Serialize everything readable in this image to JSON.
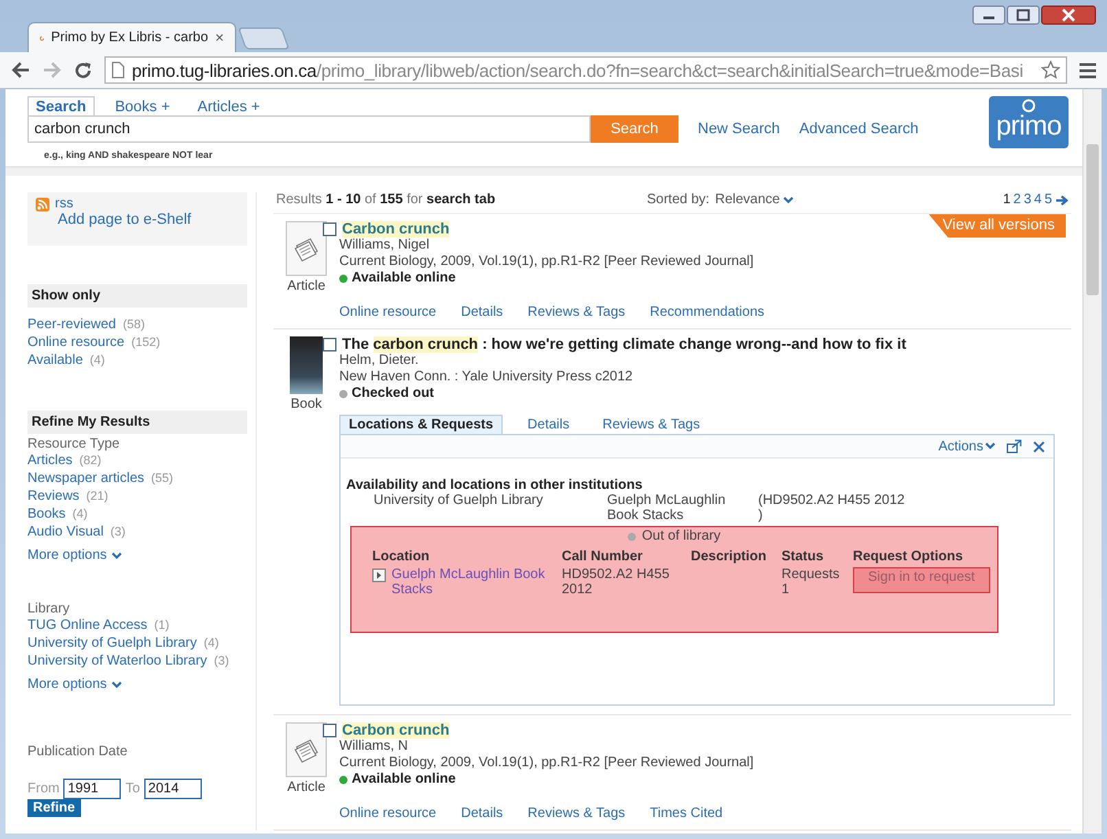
{
  "browser": {
    "tab_title": "Primo by Ex Libris - carbo",
    "tab_close": "×",
    "url_host": "primo.tug-libraries.on.ca",
    "url_path": "/primo_library/libweb/action/search.do?fn=search&ct=search&initialSearch=true&mode=Basi"
  },
  "search": {
    "tabs": [
      {
        "label": "Search",
        "selected": true
      },
      {
        "label": "Books +",
        "selected": false
      },
      {
        "label": "Articles +",
        "selected": false
      }
    ],
    "query": "carbon crunch",
    "button": "Search",
    "links": [
      "New Search",
      "Advanced Search"
    ],
    "hint": "e.g., king AND shakespeare NOT lear",
    "logo": "primo"
  },
  "sidebar": {
    "rss": "rss",
    "eshelf": "Add page to e-Shelf",
    "show_only": {
      "title": "Show only",
      "facets": [
        {
          "label": "Peer-reviewed",
          "count": "(58)"
        },
        {
          "label": "Online resource",
          "count": "(152)"
        },
        {
          "label": "Available",
          "count": "(4)"
        }
      ]
    },
    "refine": {
      "title": "Refine My Results",
      "groups": [
        {
          "heading": "Resource Type",
          "facets": [
            {
              "label": "Articles",
              "count": "(82)"
            },
            {
              "label": "Newspaper articles",
              "count": "(55)"
            },
            {
              "label": "Reviews",
              "count": "(21)"
            },
            {
              "label": "Books",
              "count": "(4)"
            },
            {
              "label": "Audio Visual",
              "count": "(3)"
            }
          ],
          "more": "More options"
        },
        {
          "heading": "Library",
          "facets": [
            {
              "label": "TUG Online Access",
              "count": "(1)"
            },
            {
              "label": "University of Guelph Library",
              "count": "(4)"
            },
            {
              "label": "University of Waterloo Library",
              "count": "(3)"
            }
          ],
          "more": "More options"
        }
      ]
    },
    "date": {
      "title": "Publication Date",
      "from_label": "From",
      "from": "1991",
      "to_label": "To",
      "to": "2014",
      "button": "Refine"
    }
  },
  "results": {
    "summary": "Results **1 - 10** of **155**  for **search tab**",
    "sort_label": "Sorted by:",
    "sort_value": "Relevance",
    "pages": [
      {
        "label": "1",
        "selected": true
      },
      {
        "label": "2",
        "selected": false
      },
      {
        "label": "3",
        "selected": false
      },
      {
        "label": "4",
        "selected": false
      },
      {
        "label": "5",
        "selected": false
      }
    ],
    "items": [
      {
        "kind": "article",
        "type_label": "Article",
        "checked": false,
        "linked": true,
        "title": [
          {
            "text": "Carbon crunch",
            "highlight": true
          }
        ],
        "author": "Williams, Nigel",
        "source": "Current Biology, 2009, Vol.19(1), pp.R1-R2 [Peer Reviewed Journal]",
        "availability": {
          "text": "Available online",
          "available": true
        },
        "badge": "View all versions",
        "links": [
          "Online resource",
          "Details",
          "Reviews & Tags",
          "Recommendations"
        ]
      },
      {
        "kind": "book",
        "type_label": "Book",
        "checked": false,
        "linked": false,
        "title": [
          {
            "text": "The ",
            "highlight": false
          },
          {
            "text": "carbon crunch",
            "highlight": true
          },
          {
            "text": " : how we're getting climate change wrong--and how to fix it",
            "highlight": false
          }
        ],
        "author": "Helm, Dieter.",
        "source": "New Haven Conn. : Yale University Press c2012",
        "availability": {
          "text": "Checked out",
          "available": false
        },
        "panel": {
          "tabs": [
            {
              "label": "Locations & Requests",
              "selected": true
            },
            {
              "label": "Details",
              "selected": false
            },
            {
              "label": "Reviews & Tags",
              "selected": false
            }
          ],
          "actions": "Actions",
          "heading": "Availability and locations in other institutions",
          "institution": {
            "name": "University of Guelph Library",
            "location": "Guelph McLaughlin Book Stacks",
            "call_number": "(HD9502.A2 H455 2012 )"
          },
          "location_status": {
            "text": "Out of library",
            "available": false
          },
          "columns": [
            "Location",
            "Call Number",
            "Description",
            "Status",
            "Request Options"
          ],
          "rows": [
            {
              "location": "Guelph McLaughlin Book Stacks",
              "call_number": "HD9502.A2 H455 2012",
              "status": "Requests 1",
              "request": "Sign in to request"
            }
          ]
        }
      },
      {
        "kind": "article",
        "type_label": "Article",
        "checked": false,
        "linked": true,
        "title": [
          {
            "text": "Carbon crunch",
            "highlight": true
          }
        ],
        "author": "Williams, N",
        "source": "Current Biology, 2009, Vol.19(1), pp.R1-R2 [Peer Reviewed Journal]",
        "availability": {
          "text": "Available online",
          "available": true
        },
        "links": [
          "Online resource",
          "Details",
          "Reviews & Tags",
          "Times Cited"
        ]
      }
    ]
  }
}
